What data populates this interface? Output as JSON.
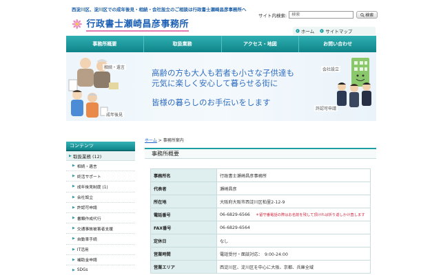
{
  "header": {
    "tagline": "西淀川区、淀川区での成年後見・相続・会社設立のご相談は行政書士瀬崎昌彦事務所へ",
    "logo_text": "行政書士瀬崎昌彦事務所",
    "search": {
      "label": "サイト内検索:",
      "placeholder": "検索",
      "button": "検索"
    },
    "links": [
      {
        "label": "ホーム",
        "icon": "home-icon"
      },
      {
        "label": "サイトマップ",
        "icon": "sitemap-icon"
      }
    ]
  },
  "nav": [
    "事務所概要",
    "取扱業務",
    "アクセス・地図",
    "お問い合わせ"
  ],
  "hero": {
    "line1": "高齢の方も大人も若者も小さな子供達も",
    "line2": "元気に楽しく安心して暮らせる街に",
    "line3": "皆様の暮らしのお手伝いをします",
    "tags": [
      "相続・遺言",
      "成年後見",
      "会社設立",
      "許認可申請"
    ]
  },
  "breadcrumb": {
    "home": "ホーム",
    "separator": ">",
    "current": "事務所案内"
  },
  "sidebar": {
    "heading": "コンテンツ",
    "category": "取扱業務 (12)",
    "items": [
      "相続・遺言",
      "終活サポート",
      "成年後見制度 (1)",
      "会社設立",
      "許認可申請",
      "書類作成代行",
      "交通事故被害者支援",
      "自動車手続",
      "IT活用",
      "補助金申請",
      "SDGs"
    ]
  },
  "content": {
    "title": "事務所概要",
    "rows": [
      {
        "label": "事務所名",
        "value": "行政書士瀬崎昌彦事務所",
        "note": ""
      },
      {
        "label": "代表者",
        "value": "瀬崎昌彦",
        "note": ""
      },
      {
        "label": "所在地",
        "value": "大阪府大阪市西淀川区柏里2-12-9",
        "note": ""
      },
      {
        "label": "電話番号",
        "value": "06-6829-6566",
        "note": "＊留守番電話の際はお名前を残して頂ければ折り返しかけ直します"
      },
      {
        "label": "FAX番号",
        "value": "06-6829-6564",
        "note": ""
      },
      {
        "label": "定休日",
        "value": "なし",
        "note": ""
      },
      {
        "label": "営業時間",
        "value": "電話受付・面談対応：　9:00-24:00",
        "note": ""
      },
      {
        "label": "営業エリア",
        "value": "西淀川区、淀川区を中心に大阪、京都、兵庫全域",
        "note": ""
      }
    ]
  },
  "colors": {
    "brand_blue": "#1a5fb4",
    "teal": "#1a9ea1",
    "note_red": "#d0203a",
    "flower_pink": "#e37ab2"
  }
}
